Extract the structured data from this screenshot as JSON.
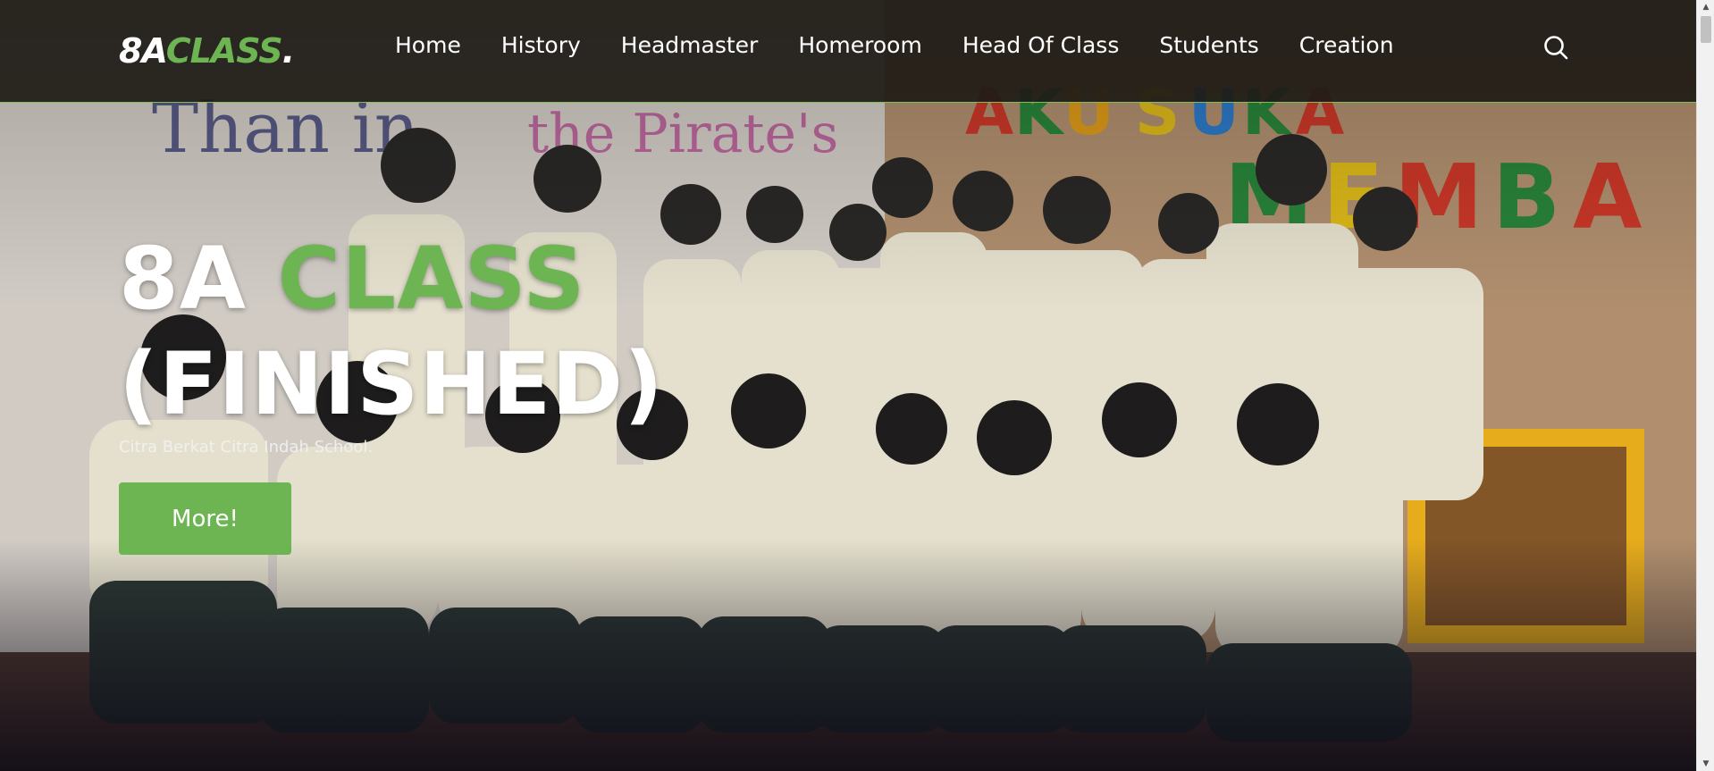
{
  "site": {
    "logo_prefix": "8A",
    "logo_accent": "CLASS",
    "logo_suffix": "."
  },
  "nav": {
    "items": [
      {
        "label": "Home"
      },
      {
        "label": "History"
      },
      {
        "label": "Headmaster"
      },
      {
        "label": "Homeroom"
      },
      {
        "label": "Head Of Class"
      },
      {
        "label": "Students"
      },
      {
        "label": "Creation"
      }
    ],
    "search_icon": "search-icon"
  },
  "hero": {
    "title_prefix": "8A ",
    "title_accent": "CLASS",
    "title_line2": "(FINISHED)",
    "subtitle": "Citra Berkat Citra Indah School.",
    "button_label": "More!",
    "background_image": "class-group-photo"
  },
  "colors": {
    "accent": "#6cb552",
    "navbar_bg": "#1e1b16",
    "text": "#ffffff"
  }
}
